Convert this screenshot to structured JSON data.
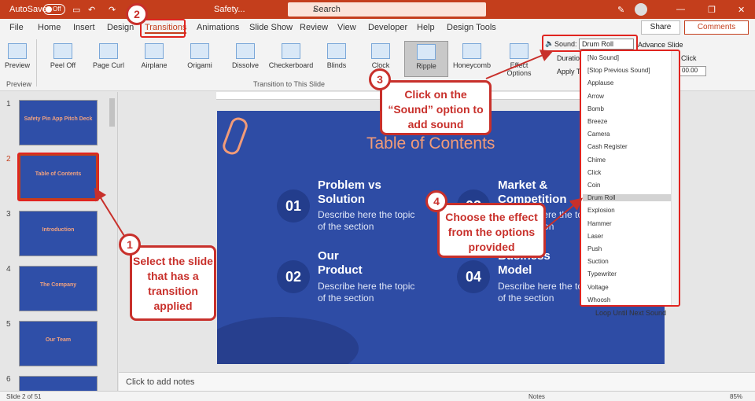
{
  "titlebar": {
    "autosave_label": "AutoSave",
    "autosave_state": "Off",
    "doc_title": "Safety...",
    "search_placeholder": "Search"
  },
  "menu": {
    "items": [
      "File",
      "Home",
      "Insert",
      "Design",
      "Transitions",
      "Animations",
      "Slide Show",
      "Review",
      "View",
      "Developer",
      "Help",
      "Design Tools"
    ],
    "share": "Share",
    "comments": "Comments"
  },
  "ribbon": {
    "preview": "Preview",
    "preview_group": "Preview",
    "transitions": [
      "Peel Off",
      "Page Curl",
      "Airplane",
      "Origami",
      "Dissolve",
      "Checkerboard",
      "Blinds",
      "Clock",
      "Ripple",
      "Honeycomb"
    ],
    "active_transition": "Ripple",
    "group_label": "Transition to This Slide",
    "effect_options": "Effect Options",
    "sound_label": "Sound:",
    "sound_value": "Drum Roll",
    "advance_slide": "Advance Slide",
    "duration_label": "Duration",
    "apply_label": "Apply To",
    "on_click": "Click",
    "after_value": "00.00"
  },
  "sound_options": [
    "[No Sound]",
    "[Stop Previous Sound]",
    "Applause",
    "Arrow",
    "Bomb",
    "Breeze",
    "Camera",
    "Cash Register",
    "Chime",
    "Click",
    "Coin",
    "Drum Roll",
    "Explosion",
    "Hammer",
    "Laser",
    "Push",
    "Suction",
    "Typewriter",
    "Voltage",
    "Whoosh"
  ],
  "sound_selected": "Drum Roll",
  "loop_label": "Loop Until Next Sound",
  "thumbnails": [
    {
      "num": "1",
      "title": "Safety Pin App Pitch Deck"
    },
    {
      "num": "2",
      "title": "Table of Contents"
    },
    {
      "num": "3",
      "title": "Introduction"
    },
    {
      "num": "4",
      "title": "The Company"
    },
    {
      "num": "5",
      "title": "Our Team"
    },
    {
      "num": "6",
      "title": ""
    }
  ],
  "slide": {
    "title": "Table of Contents",
    "items": [
      {
        "num": "01",
        "title": "Problem vs Solution",
        "desc": "Describe here the topic of the section"
      },
      {
        "num": "02",
        "title": "Our Product",
        "desc": "Describe here the topic of the section"
      },
      {
        "num": "03",
        "title": "Market & Competition",
        "desc": "Describe here the topic of the section"
      },
      {
        "num": "04",
        "title": "Business Model",
        "desc": "Describe here the topic of the section"
      }
    ]
  },
  "notes_placeholder": "Click to add notes",
  "status": {
    "slide_count": "Slide 2 of 51",
    "notes": "Notes",
    "zoom": "85%"
  },
  "callouts": {
    "c1_num": "1",
    "c1_text": "Select the slide that has a transition applied",
    "c2_num": "2",
    "c3_num": "3",
    "c3_text": "Click on the “Sound” option to add sound",
    "c4_num": "4",
    "c4_text": "Choose the effect from the options provided"
  },
  "colors": {
    "accent": "#c43e1c",
    "callout": "#c8302b",
    "slide_bg": "#2e4ca5",
    "slide_title": "#f29b78"
  }
}
